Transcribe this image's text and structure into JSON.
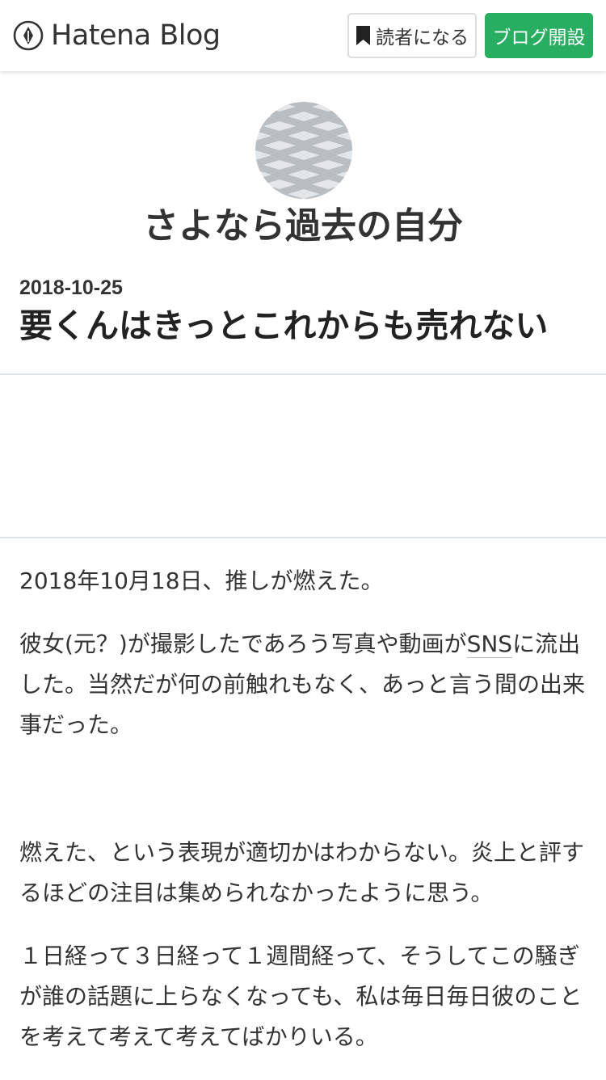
{
  "header": {
    "logo_text": "Hatena Blog",
    "subscribe_label": "読者になる",
    "create_blog_label": "ブログ開設",
    "accent_color": "#27ae60"
  },
  "blog": {
    "title": "さよなら過去の自分"
  },
  "entry": {
    "date": "2018-10-25",
    "title": "要くんはきっとこれからも売れない",
    "paragraphs": {
      "p1": "2018年10月18日、推しが燃えた。",
      "p2_before": "彼女(元？)が撮影したであろう写真や動画が",
      "p2_keyword": "SNS",
      "p2_after": "に流出した。当然だが何の前触れもなく、あっと言う間の出来事だった。",
      "p3": "燃えた、という表現が適切かはわからない。炎上と評するほどの注目は集められなかったように思う。",
      "p4": "１日経って３日経って１週間経って、そうしてこの騒ぎが誰の話題に上らなくなっても、私は毎日毎日彼のことを考えて考えて考えてばかりいる。"
    }
  }
}
